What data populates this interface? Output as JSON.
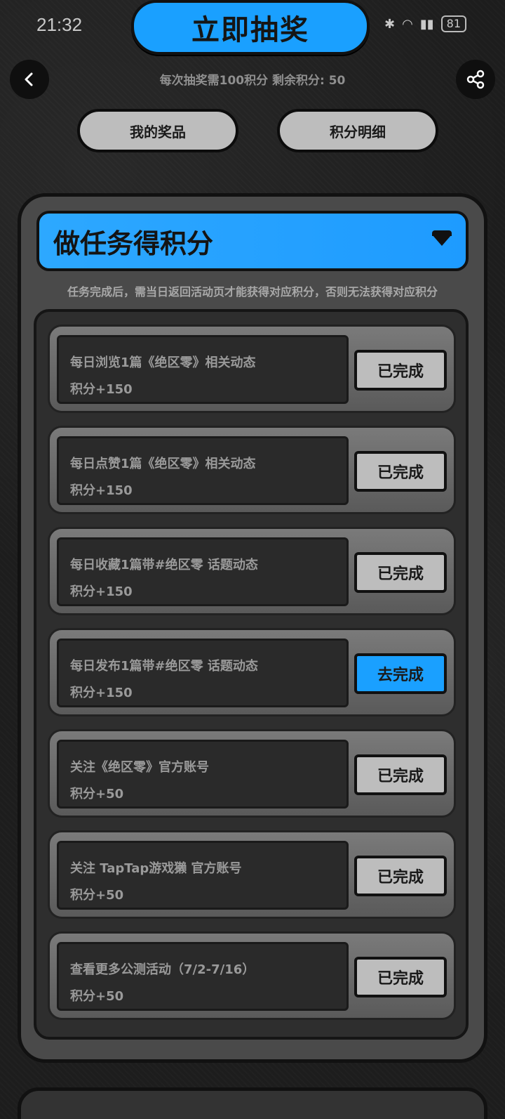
{
  "status": {
    "time": "21:32",
    "battery": "81"
  },
  "banner": {
    "label": "立即抽奖"
  },
  "points_info": "每次抽奖需100积分 剩余积分: 50",
  "nav": {
    "my_prizes": "我的奖品",
    "points_detail": "积分明细"
  },
  "panel": {
    "title": "做任务得积分",
    "note": "任务完成后，需当日返回活动页才能获得对应积分，否则无法获得对应积分"
  },
  "tasks": [
    {
      "title": "每日浏览1篇《绝区零》相关动态",
      "points": "积分+150",
      "button": "已完成",
      "done": true
    },
    {
      "title": "每日点赞1篇《绝区零》相关动态",
      "points": "积分+150",
      "button": "已完成",
      "done": true
    },
    {
      "title": "每日收藏1篇带#绝区零 话题动态",
      "points": "积分+150",
      "button": "已完成",
      "done": true
    },
    {
      "title": "每日发布1篇带#绝区零 话题动态",
      "points": "积分+150",
      "button": "去完成",
      "done": false
    },
    {
      "title": "关注《绝区零》官方账号",
      "points": "积分+50",
      "button": "已完成",
      "done": true
    },
    {
      "title": "关注 TapTap游戏獭 官方账号",
      "points": "积分+50",
      "button": "已完成",
      "done": true
    },
    {
      "title": "查看更多公测活动（7/2-7/16）",
      "points": "积分+50",
      "button": "已完成",
      "done": true
    }
  ],
  "colors": {
    "accent": "#1aa0ff",
    "done_button": "#bdbdbd"
  },
  "icons": {
    "back": "chevron-left-icon",
    "share": "share-icon",
    "collapse": "caret-down-icon"
  }
}
